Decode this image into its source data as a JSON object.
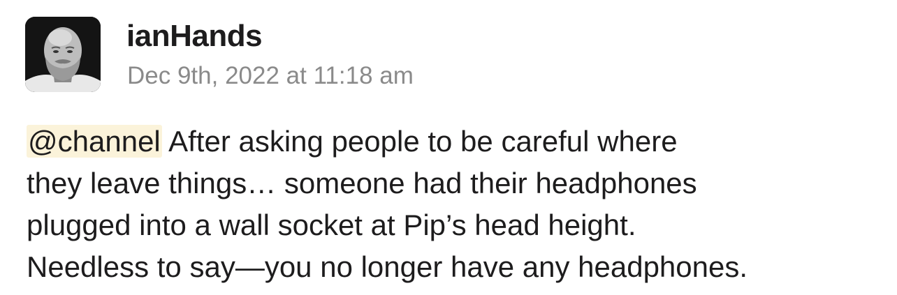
{
  "message": {
    "author": "ianHands",
    "timestamp": "Dec 9th, 2022 at 11:18 am",
    "mention": "@channel",
    "text_lines": [
      "After asking people to be careful where",
      "they leave things… someone had their headphones",
      "plugged into a wall socket at Pip’s head height.",
      "Needless to say—you no longer have any headphones."
    ]
  },
  "colors": {
    "mention_highlight": "#fbf3da",
    "timestamp": "#8a8a8a",
    "text": "#1d1c1d"
  }
}
